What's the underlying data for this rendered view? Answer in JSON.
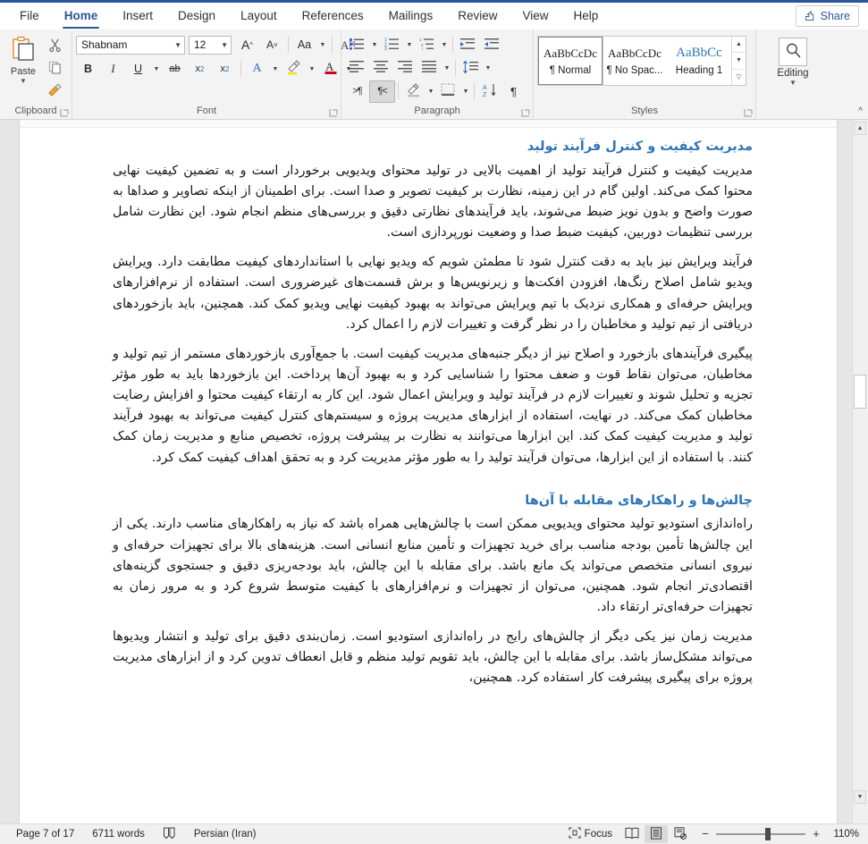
{
  "window": {
    "tabs": [
      {
        "label": "File",
        "active": false
      },
      {
        "label": "Home",
        "active": true
      },
      {
        "label": "Insert",
        "active": false
      },
      {
        "label": "Design",
        "active": false
      },
      {
        "label": "Layout",
        "active": false
      },
      {
        "label": "References",
        "active": false
      },
      {
        "label": "Mailings",
        "active": false
      },
      {
        "label": "Review",
        "active": false
      },
      {
        "label": "View",
        "active": false
      },
      {
        "label": "Help",
        "active": false
      }
    ],
    "share_label": "Share",
    "accent_color": "#2b579a"
  },
  "ribbon": {
    "clipboard": {
      "group_label": "Clipboard",
      "paste_label": "Paste",
      "cut_name": "cut-icon",
      "copy_name": "copy-icon",
      "format_painter_name": "format-painter-icon"
    },
    "font": {
      "group_label": "Font",
      "font_name": "Shabnam",
      "font_size": "12",
      "grow_label": "A",
      "shrink_label": "A",
      "case_label": "Aa",
      "clear_format_label": "A",
      "bold_label": "B",
      "italic_label": "I",
      "underline_label": "U",
      "strikethrough_label": "ab",
      "subscript_label": "x",
      "superscript_label": "x",
      "text_effects_label": "A",
      "highlight_label": "A",
      "font_color_label": "A",
      "highlight_color": "#ffe400",
      "font_color": "#d0021b"
    },
    "paragraph": {
      "group_label": "Paragraph",
      "bullets_name": "bullets-icon",
      "numbering_name": "numbering-icon",
      "multilevel_name": "multilevel-list-icon",
      "decrease_indent_name": "decrease-indent-icon",
      "increase_indent_name": "increase-indent-icon",
      "align_left_name": "align-left-icon",
      "align_center_name": "align-center-icon",
      "align_right_name": "align-right-icon",
      "justify_name": "justify-icon",
      "line_spacing_name": "line-spacing-icon",
      "ltr_label": "¶",
      "rtl_label": "¶",
      "shading_name": "shading-icon",
      "borders_name": "borders-icon",
      "sort_label": "A Z",
      "show_marks_label": "¶"
    },
    "styles": {
      "group_label": "Styles",
      "items": [
        {
          "preview": "AaBbCcDc",
          "name": "¶ Normal",
          "selected": true,
          "heading": false
        },
        {
          "preview": "AaBbCcDc",
          "name": "¶ No Spac...",
          "selected": false,
          "heading": false
        },
        {
          "preview": "AaBbCс",
          "name": "Heading 1",
          "selected": false,
          "heading": true
        }
      ]
    },
    "editing": {
      "group_label": "Editing",
      "find_name": "search-icon"
    }
  },
  "document": {
    "blocks": [
      {
        "type": "heading",
        "text": "مدیریت کیفیت و کنترل فرآیند تولید"
      },
      {
        "type": "para",
        "text": "مدیریت کیفیت و کنترل فرآیند تولید از اهمیت بالایی در تولید محتوای ویدیویی برخوردار است و به تضمین کیفیت نهایی محتوا کمک می‌کند. اولین گام در این زمینه، نظارت بر کیفیت تصویر و صدا است. برای اطمینان از اینکه تصاویر و صداها به صورت واضح و بدون نویز ضبط می‌شوند، باید فرآیندهای نظارتی دقیق و بررسی‌های منظم انجام شود. این نظارت شامل بررسی تنظیمات دوربین، کیفیت ضبط صدا و وضعیت نورپردازی است."
      },
      {
        "type": "para",
        "text": "فرآیند ویرایش نیز باید به دقت کنترل شود تا مطمئن شویم که ویدیو نهایی با استانداردهای کیفیت مطابقت دارد. ویرایش ویدیو شامل اصلاح رنگ‌ها، افزودن افکت‌ها و زیرنویس‌ها و برش قسمت‌های غیرضروری است. استفاده از نرم‌افزارهای ویرایش حرفه‌ای و همکاری نزدیک با تیم ویرایش می‌تواند به بهبود کیفیت نهایی ویدیو کمک کند. همچنین، باید بازخوردهای دریافتی از تیم تولید و مخاطبان را در نظر گرفت و تغییرات لازم را اعمال کرد."
      },
      {
        "type": "para",
        "text": "پیگیری فرآیندهای بازخورد و اصلاح نیز از دیگر جنبه‌های مدیریت کیفیت است. با جمع‌آوری بازخوردهای مستمر از تیم تولید و مخاطبان، می‌توان نقاط قوت و ضعف محتوا را شناسایی کرد و به بهبود آن‌ها پرداخت. این بازخوردها باید به طور مؤثر تجزیه و تحلیل شوند و تغییرات لازم در فرآیند تولید و ویرایش اعمال شود. این کار به ارتقاء کیفیت محتوا و افزایش رضایت مخاطبان کمک می‌کند. در نهایت، استفاده از ابزارهای مدیریت پروژه و سیستم‌های کنترل کیفیت می‌تواند به بهبود فرآیند تولید و مدیریت کیفیت کمک کند. این ابزارها می‌توانند به نظارت بر پیشرفت پروژه، تخصیص منابع و مدیریت زمان کمک کنند. با استفاده از این ابزارها، می‌توان فرآیند تولید را به طور مؤثر مدیریت کرد و به تحقق اهداف کیفیت کمک کرد."
      },
      {
        "type": "heading2",
        "text": "چالش‌ها و راهکارهای مقابله با آن‌ها"
      },
      {
        "type": "para",
        "text": "راه‌اندازی استودیو تولید محتوای ویدیویی ممکن است با چالش‌هایی همراه باشد که نیاز به راهکارهای مناسب دارند. یکی از این چالش‌ها تأمین بودجه مناسب برای خرید تجهیزات و تأمین منابع انسانی است. هزینه‌های بالا برای تجهیزات حرفه‌ای و نیروی انسانی متخصص می‌تواند یک مانع باشد. برای مقابله با این چالش، باید بودجه‌ریزی دقیق و جستجوی گزینه‌های اقتصادی‌تر انجام شود. همچنین، می‌توان از تجهیزات و نرم‌افزارهای با کیفیت متوسط شروع کرد و به مرور زمان به تجهیزات حرفه‌ای‌تر ارتقاء داد."
      },
      {
        "type": "para",
        "text": "مدیریت زمان نیز یکی دیگر از چالش‌های رایج در راه‌اندازی استودیو است. زمان‌بندی دقیق برای تولید و انتشار ویدیوها می‌تواند مشکل‌ساز باشد. برای مقابله با این چالش، باید تقویم تولید منظم و قابل انعطاف تدوین کرد و از ابزارهای مدیریت پروژه برای پیگیری پیشرفت کار استفاده کرد. همچنین،"
      }
    ]
  },
  "status": {
    "page": "Page 7 of 17",
    "words": "6711 words",
    "proofing_name": "proofing-icon",
    "language": "Persian (Iran)",
    "focus_label": "Focus",
    "view_read_name": "read-mode-icon",
    "view_print_name": "print-layout-icon",
    "view_web_name": "web-layout-icon",
    "zoom_out": "−",
    "zoom_in": "+",
    "zoom_value": "110%"
  }
}
